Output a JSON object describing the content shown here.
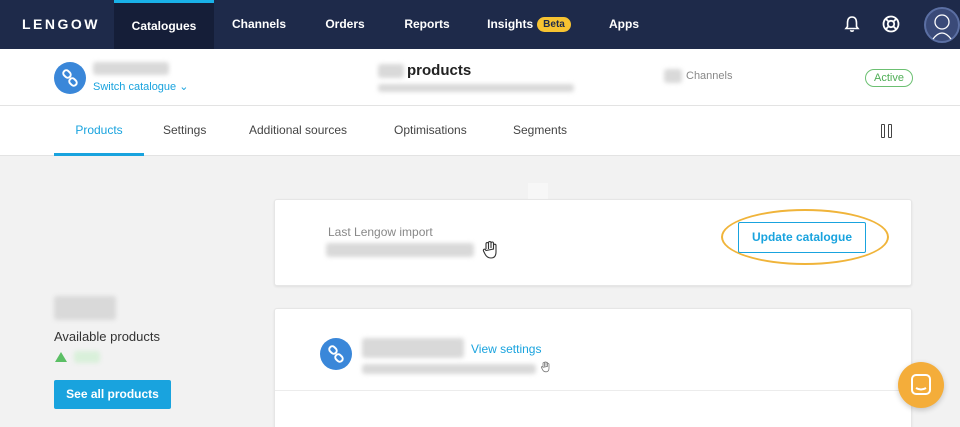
{
  "topnav": {
    "logo": "LENGOW",
    "items": [
      {
        "label": "Catalogues",
        "active": true
      },
      {
        "label": "Channels"
      },
      {
        "label": "Orders"
      },
      {
        "label": "Reports"
      },
      {
        "label": "Insights",
        "badge": "Beta"
      },
      {
        "label": "Apps"
      }
    ],
    "icons": [
      "bell-icon",
      "help-icon",
      "avatar"
    ]
  },
  "catalogue_header": {
    "switch_label": "Switch catalogue",
    "products_label": "products",
    "channels_label": "Channels",
    "status": "Active"
  },
  "tabs": [
    {
      "label": "Products",
      "active": true
    },
    {
      "label": "Settings"
    },
    {
      "label": "Additional sources"
    },
    {
      "label": "Optimisations"
    },
    {
      "label": "Segments"
    }
  ],
  "import_card": {
    "last_import_label": "Last Lengow import",
    "update_button": "Update catalogue"
  },
  "sidebar": {
    "available_label": "Available products",
    "see_all_button": "See all products"
  },
  "source_card": {
    "view_settings": "View settings"
  },
  "colors": {
    "nav_bg": "#1e2a4a",
    "accent": "#19a3de",
    "highlight": "#f0b43a",
    "active_green": "#4fae56"
  }
}
